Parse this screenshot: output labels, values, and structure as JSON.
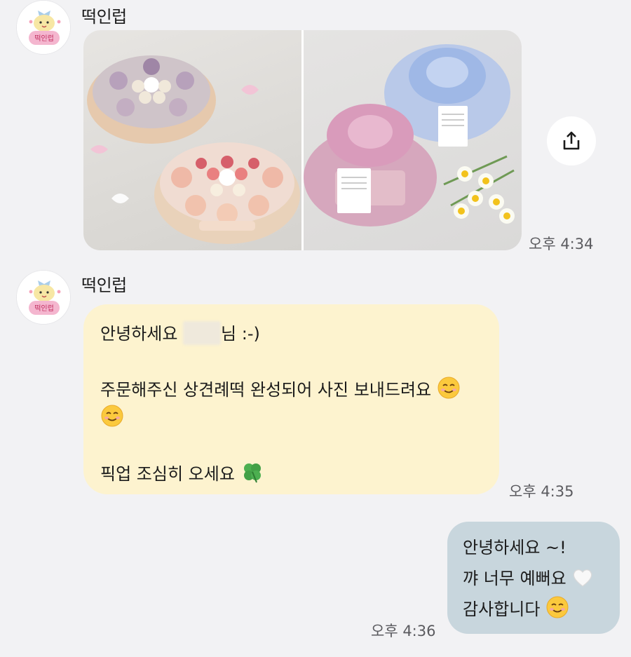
{
  "messages": [
    {
      "sender": "떡인럽",
      "avatar_text": "떡인럽",
      "type": "photos",
      "time": "오후 4:34"
    },
    {
      "sender": "떡인럽",
      "avatar_text": "떡인럽",
      "type": "text",
      "lines": [
        {
          "before": "안녕하세요",
          "after": "님 :-)"
        },
        {
          "text": "주문해주신 상견례떡 완성되어 사진 보내드려요"
        },
        {
          "text": "픽업 조심히 오세요"
        }
      ],
      "time": "오후 4:35"
    },
    {
      "sender": "me",
      "type": "text",
      "lines": [
        "안녕하세요 ~!",
        "꺄 너무 예뻐요",
        "감사합니다"
      ],
      "time": "오후 4:36"
    }
  ],
  "icons": {
    "share": "share-icon",
    "smile": "smiling-face-emoji",
    "clover": "four-leaf-clover-emoji",
    "heart": "white-heart-emoji"
  },
  "colors": {
    "incoming_bubble": "#fdf3cf",
    "outgoing_bubble": "#c8d6dd",
    "background": "#f2f2f4"
  }
}
